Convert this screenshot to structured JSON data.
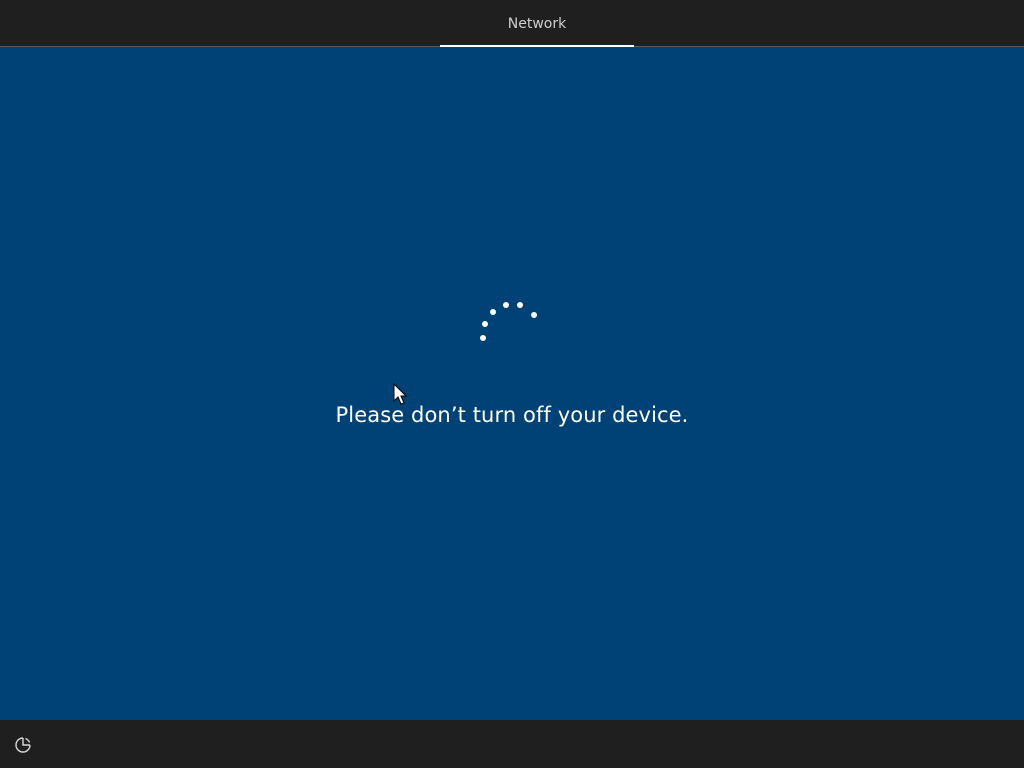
{
  "header": {
    "active_tab_label": "Network"
  },
  "main": {
    "message": "Please don’t turn off your device.",
    "status_indicator": "loading-spinner"
  },
  "footer": {
    "accessibility_button_icon": "ease-of-access-icon"
  },
  "colors": {
    "background": "#004275",
    "bar": "#1f1f1f",
    "text": "#ffffff",
    "tab_text": "#cfcfcf"
  }
}
